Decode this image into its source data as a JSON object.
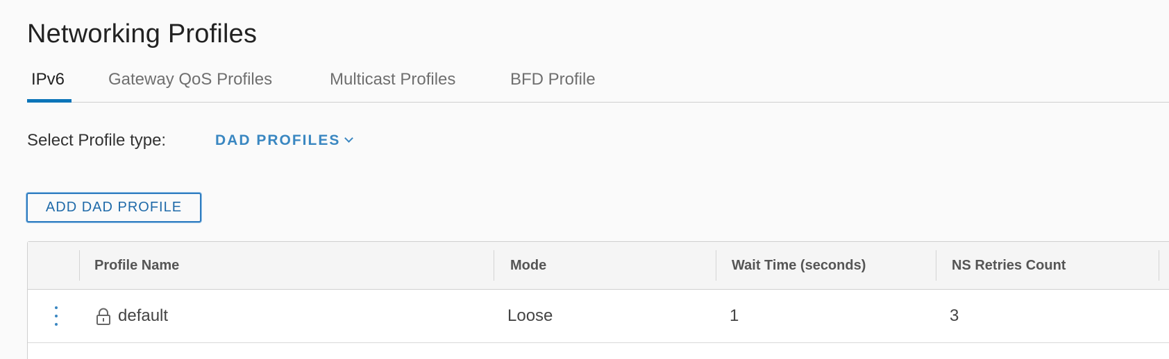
{
  "page": {
    "title": "Networking Profiles"
  },
  "tabs": [
    {
      "label": "IPv6",
      "active": true
    },
    {
      "label": "Gateway QoS Profiles",
      "active": false
    },
    {
      "label": "Multicast Profiles",
      "active": false
    },
    {
      "label": "BFD Profile",
      "active": false
    }
  ],
  "profile_type": {
    "label": "Select Profile type:",
    "selected": "DAD PROFILES",
    "icon": "chevron-down-icon"
  },
  "actions": {
    "add_label": "ADD DAD PROFILE"
  },
  "grid": {
    "columns": [
      "Profile Name",
      "Mode",
      "Wait Time (seconds)",
      "NS Retries Count"
    ],
    "rows": [
      {
        "name": "default",
        "mode": "Loose",
        "wait_time": "1",
        "ns_retries": "3",
        "locked": true
      }
    ]
  },
  "colors": {
    "accent": "#0a74b8",
    "link": "#3a87c1"
  }
}
